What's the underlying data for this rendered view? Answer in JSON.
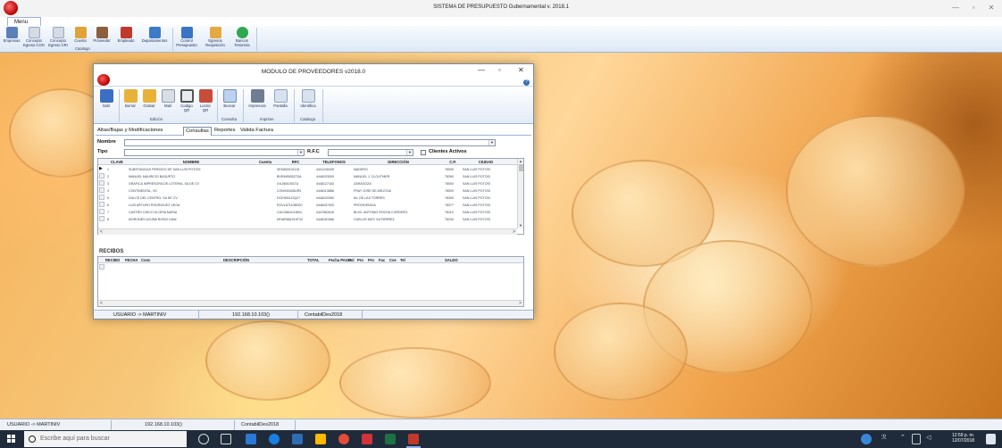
{
  "app": {
    "title": "SISTEMA DE PRESUPUESTO Gubernamental v. 2018.1",
    "menu_tab": "Menu",
    "ribbon": {
      "buttons": [
        {
          "label": "Empresas",
          "icon": "companies-icon",
          "color": "#5b7fb8"
        },
        {
          "label": "Concepto\nEgreso COG",
          "icon": "document-icon",
          "color": "#b9c3d2"
        },
        {
          "label": "Concepto\nEgreso CRI",
          "icon": "document-icon",
          "color": "#b9c3d2"
        },
        {
          "label": "Cuenta",
          "icon": "account-icon",
          "color": "#e0a33a"
        },
        {
          "label": "Proveedor",
          "icon": "supplier-icon",
          "color": "#8b5e3c"
        },
        {
          "label": "Empleado",
          "icon": "employee-icon",
          "color": "#c0392b"
        },
        {
          "label": "Departamentos",
          "icon": "departments-icon",
          "color": "#3b7bc8"
        },
        {
          "label": "Control\nPresupuesto",
          "icon": "chart-icon",
          "color": "#3a74c4"
        },
        {
          "label": "Egresos\nRequisición",
          "icon": "expenses-icon",
          "color": "#e6a941"
        },
        {
          "label": "Bancos\nTesoreria",
          "icon": "bank-icon",
          "color": "#2fa84f"
        }
      ],
      "groups": [
        "Catalogo"
      ]
    },
    "status": {
      "user": "USUARIO -> MARTINIV",
      "ip": "192.168.10.103()",
      "db": "ContabilDes2018"
    }
  },
  "window": {
    "title": "MODULO DE PROVEEDORES v2018.0",
    "help": "?",
    "ribbon": {
      "buttons": [
        {
          "label": "Salir",
          "icon": "exit-icon",
          "color": "#3b6fc4"
        },
        {
          "label": "Borrar",
          "icon": "delete-icon",
          "color": "#e8b23a"
        },
        {
          "label": "Grabar",
          "icon": "save-icon",
          "color": "#e8b23a"
        },
        {
          "label": "Mail",
          "icon": "mail-icon",
          "color": "#d8dde6"
        },
        {
          "label": "Codigo\nQR",
          "icon": "qr-code-icon",
          "color": "#7d8590"
        },
        {
          "label": "Lector\nQR",
          "icon": "qr-reader-icon",
          "color": "#c94b3a"
        },
        {
          "label": "Buscar",
          "icon": "search-icon",
          "color": "#bcd2ee"
        },
        {
          "label": "Impresora",
          "icon": "printer-icon",
          "color": "#6f7d92"
        },
        {
          "label": "Pantalla",
          "icon": "screen-icon",
          "color": "#d7e1ef"
        },
        {
          "label": "Identifica",
          "icon": "identify-icon",
          "color": "#d7e1ef"
        }
      ],
      "groups": [
        "Edición",
        "Consulta",
        "Imprime",
        "Catalogo"
      ]
    },
    "tabs": [
      "Altas/Bajas y Modificaciones",
      "Consultas",
      "Reportes",
      "Valida Factura"
    ],
    "filters": {
      "nombre_label": "Nombre",
      "tipo_label": "Tipo",
      "rfc_label": "R.F.C",
      "clientes_activos_label": "Clientes Activos"
    },
    "grid": {
      "columns": [
        "CLAVE",
        "NOMBRE",
        "Cuenta",
        "RFC",
        "TELEFONOS",
        "DIRECCIÓN",
        "C.P.",
        "CIUDAD"
      ],
      "rows": [
        {
          "clave": "1",
          "nombre": "SUBSTANCIAS PERIODO DE SAN LUIS POTOSI",
          "cuenta": "",
          "rfc": "SEM830101134",
          "tel": "4441245435",
          "dir": "MADERO",
          "cp": "78000",
          "ciudad": "SAN LUIS POTOSI"
        },
        {
          "clave": "2",
          "nombre": "MANUEL MAURICIO BASURTO",
          "cuenta": "",
          "rfc": "BURM590527DA",
          "tel": "4448203000",
          "dir": "MANUEL J. CLOUTHIER",
          "cp": "78260",
          "ciudad": "SAN LUIS POTOSI"
        },
        {
          "clave": "3",
          "nombre": "GRAFICA IMPRESORA DE LOTERIA, SA DE CV",
          "cuenta": "",
          "rfc": "GIL0601001TA",
          "tel": "4448127163",
          "dir": "ZARAGOZA",
          "cp": "78000",
          "ciudad": "SAN LUIS POTOSI"
        },
        {
          "clave": "4",
          "nombre": "CONTINENTAL, SC",
          "cuenta": "",
          "rfc": "CON940408UR3",
          "tel": "4448113888",
          "dir": "FRAY JOSE DE ARLEGUI",
          "cp": "78000",
          "ciudad": "SAN LUIS POTOSI"
        },
        {
          "clave": "5",
          "nombre": "DULCE DEL CENTRO, SA DE CV",
          "cuenta": "",
          "rfc": "DCE900112Q27",
          "tel": "4448220060",
          "dir": "AV. DE LAS TORRES",
          "cp": "78390",
          "ciudad": "SAN LUIS POTOSI"
        },
        {
          "clave": "6",
          "nombre": "LUIS ARTURO RODRIGUEZ VEGA",
          "cuenta": "",
          "rfc": "ROVL871108ED0",
          "tel": "4448437000",
          "dir": "PROVIDENCIA",
          "cp": "78377",
          "ciudad": "SAN LUIS POTOSI"
        },
        {
          "clave": "7",
          "nombre": "CASTRO CHICO GLORIA MARIA",
          "cuenta": "",
          "rfc": "CACG861013IB4",
          "tel": "4447662616",
          "dir": "BLVD. ANTONIO ROCHA CORDERO",
          "cp": "78110",
          "ciudad": "SAN LUIS POTOSI"
        },
        {
          "clave": "8",
          "nombre": "MORONES ACUÑA ROSIO IVAN",
          "cuenta": "",
          "rfc": "MOAR861019T22",
          "tel": "4448161566",
          "dir": "CARLOS DIEZ GUTIERREZ",
          "cp": "78230",
          "ciudad": "SAN LUIS POTOSI"
        }
      ]
    },
    "recibos": {
      "title": "RECIBOS",
      "columns": [
        "RECIBO",
        "FECHA",
        "Conc",
        "DESCRIPCIÓN",
        "TOTAL",
        "Fecha PAGO",
        "Pol",
        "Pro",
        "Pro",
        "Fac",
        "Cve",
        "Tel",
        "SALDO"
      ]
    },
    "status": {
      "user": "USUARIO -> MARTINIV",
      "ip": "192.168.10.103()",
      "db": "ContabilDes2018"
    }
  },
  "taskbar": {
    "search_placeholder": "Escribe aquí para buscar",
    "time": "12:59 p. m.",
    "date": "12/07/2018"
  }
}
